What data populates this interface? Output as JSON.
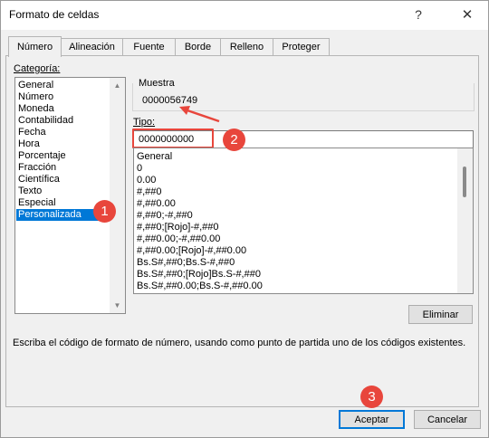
{
  "window": {
    "title": "Formato de celdas",
    "help_label": "?",
    "close_label": "✕"
  },
  "tabs": [
    {
      "label": "Número",
      "active": true
    },
    {
      "label": "Alineación",
      "active": false
    },
    {
      "label": "Fuente",
      "active": false
    },
    {
      "label": "Borde",
      "active": false
    },
    {
      "label": "Relleno",
      "active": false
    },
    {
      "label": "Proteger",
      "active": false
    }
  ],
  "category": {
    "label": "Categoría:",
    "items": [
      {
        "label": "General"
      },
      {
        "label": "Número"
      },
      {
        "label": "Moneda"
      },
      {
        "label": "Contabilidad"
      },
      {
        "label": "Fecha"
      },
      {
        "label": "Hora"
      },
      {
        "label": "Porcentaje"
      },
      {
        "label": "Fracción"
      },
      {
        "label": "Científica"
      },
      {
        "label": "Texto"
      },
      {
        "label": "Especial"
      },
      {
        "label": "Personalizada",
        "selected": true
      }
    ]
  },
  "sample": {
    "label": "Muestra",
    "value": "0000056749"
  },
  "type": {
    "label": "Tipo:",
    "value": "0000000000"
  },
  "formats": [
    "General",
    "0",
    "0.00",
    "#,##0",
    "#,##0.00",
    "#,##0;-#,##0",
    "#,##0;[Rojo]-#,##0",
    "#,##0.00;-#,##0.00",
    "#,##0.00;[Rojo]-#,##0.00",
    "Bs.S#,##0;Bs.S-#,##0",
    "Bs.S#,##0;[Rojo]Bs.S-#,##0",
    "Bs.S#,##0.00;Bs.S-#,##0.00"
  ],
  "buttons": {
    "delete": "Eliminar",
    "ok": "Aceptar",
    "cancel": "Cancelar"
  },
  "description": "Escriba el código de formato de número, usando como punto de partida uno de los códigos existentes.",
  "annotations": {
    "badge_1": "1",
    "badge_2": "2",
    "badge_3": "3",
    "color": "#e8463c"
  },
  "colors": {
    "selection": "#0078d7",
    "dialog_bg": "#f0f0f0",
    "default_button_border": "#0078d7"
  }
}
